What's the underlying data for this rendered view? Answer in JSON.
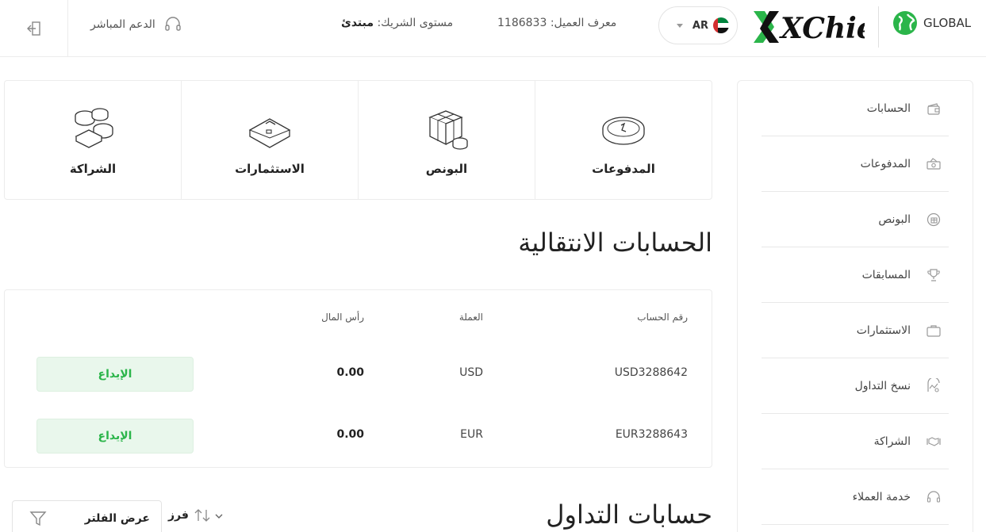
{
  "header": {
    "support_label": "الدعم المباشر",
    "partner_level_label": "مستوى الشريك:",
    "partner_level_value": "مبتدئ",
    "client_id_label": "معرف العميل:",
    "client_id_value": "1186833",
    "language": "AR",
    "brand": "XChief",
    "region": "GLOBAL"
  },
  "sidebar": {
    "items": [
      {
        "label": "الحسابات",
        "icon": "wallet-icon"
      },
      {
        "label": "المدفوعات",
        "icon": "payments-icon"
      },
      {
        "label": "البونص",
        "icon": "bonus-icon"
      },
      {
        "label": "المسابقات",
        "icon": "trophy-icon"
      },
      {
        "label": "الاستثمارات",
        "icon": "briefcase-icon"
      },
      {
        "label": "نسخ التداول",
        "icon": "copy-trading-icon"
      },
      {
        "label": "الشراكة",
        "icon": "handshake-icon"
      },
      {
        "label": "خدمة العملاء",
        "icon": "headset-icon"
      }
    ]
  },
  "cards": [
    {
      "label": "الشراكة",
      "icon": "coins-stack-icon"
    },
    {
      "label": "الاستثمارات",
      "icon": "briefcase-icon"
    },
    {
      "label": "البونص",
      "icon": "gift-box-icon"
    },
    {
      "label": "المدفوعات",
      "icon": "coin-icon"
    }
  ],
  "transfer_accounts": {
    "title": "الحسابات الانتقالية",
    "columns": {
      "account": "رقم الحساب",
      "currency": "العملة",
      "capital": "رأس المال"
    },
    "rows": [
      {
        "account": "USD3288642",
        "currency": "USD",
        "capital": "0.00",
        "action": "الإيداع"
      },
      {
        "account": "EUR3288643",
        "currency": "EUR",
        "capital": "0.00",
        "action": "الإيداع"
      }
    ]
  },
  "trading_accounts": {
    "title": "حسابات التداول",
    "filter_label": "عرض الفلتر",
    "sort_label": "فرز"
  },
  "colors": {
    "accent_green": "#2bb54a",
    "deposit_bg": "#e9f7ec"
  }
}
